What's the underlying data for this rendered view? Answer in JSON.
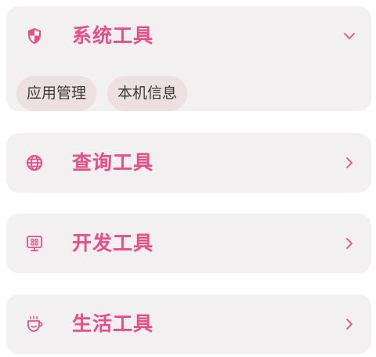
{
  "accent_color": "#ec4c86",
  "sections": [
    {
      "title": "系统工具",
      "icon": "shield-icon",
      "expanded": true,
      "items": [
        "应用管理",
        "本机信息"
      ]
    },
    {
      "title": "查询工具",
      "icon": "globe-icon",
      "expanded": false
    },
    {
      "title": "开发工具",
      "icon": "monitor-icon",
      "expanded": false
    },
    {
      "title": "生活工具",
      "icon": "cup-icon",
      "expanded": false
    }
  ]
}
